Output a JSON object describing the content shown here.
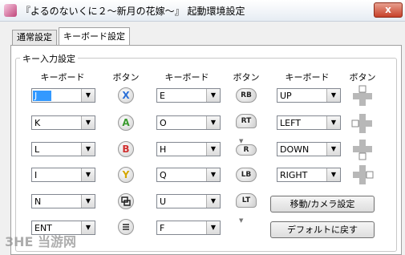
{
  "window": {
    "title": "『よるのないくに２～新月の花嫁～』 起動環境設定",
    "close": "x"
  },
  "tabs": [
    "通常設定",
    "キーボード設定"
  ],
  "group_title": "キー入力設定",
  "headers": [
    "キーボード",
    "ボタン",
    "キーボード",
    "ボタン",
    "キーボード",
    "ボタン"
  ],
  "col1": [
    "J",
    "K",
    "L",
    "I",
    "N",
    "ENT"
  ],
  "col2": [
    "E",
    "O",
    "H",
    "Q",
    "U",
    "F"
  ],
  "col3": [
    "UP",
    "LEFT",
    "DOWN",
    "RIGHT"
  ],
  "face_buttons": [
    "X",
    "A",
    "B",
    "Y"
  ],
  "face_colors": [
    "#2a6fd6",
    "#3a9a2e",
    "#d03030",
    "#d4a600"
  ],
  "shoulder_labels": [
    "RB",
    "RT",
    "R",
    "LB",
    "LT"
  ],
  "buttons": {
    "move_camera": "移動/カメラ設定",
    "reset": "デフォルトに戻す"
  },
  "watermark": "3HE 当游网"
}
